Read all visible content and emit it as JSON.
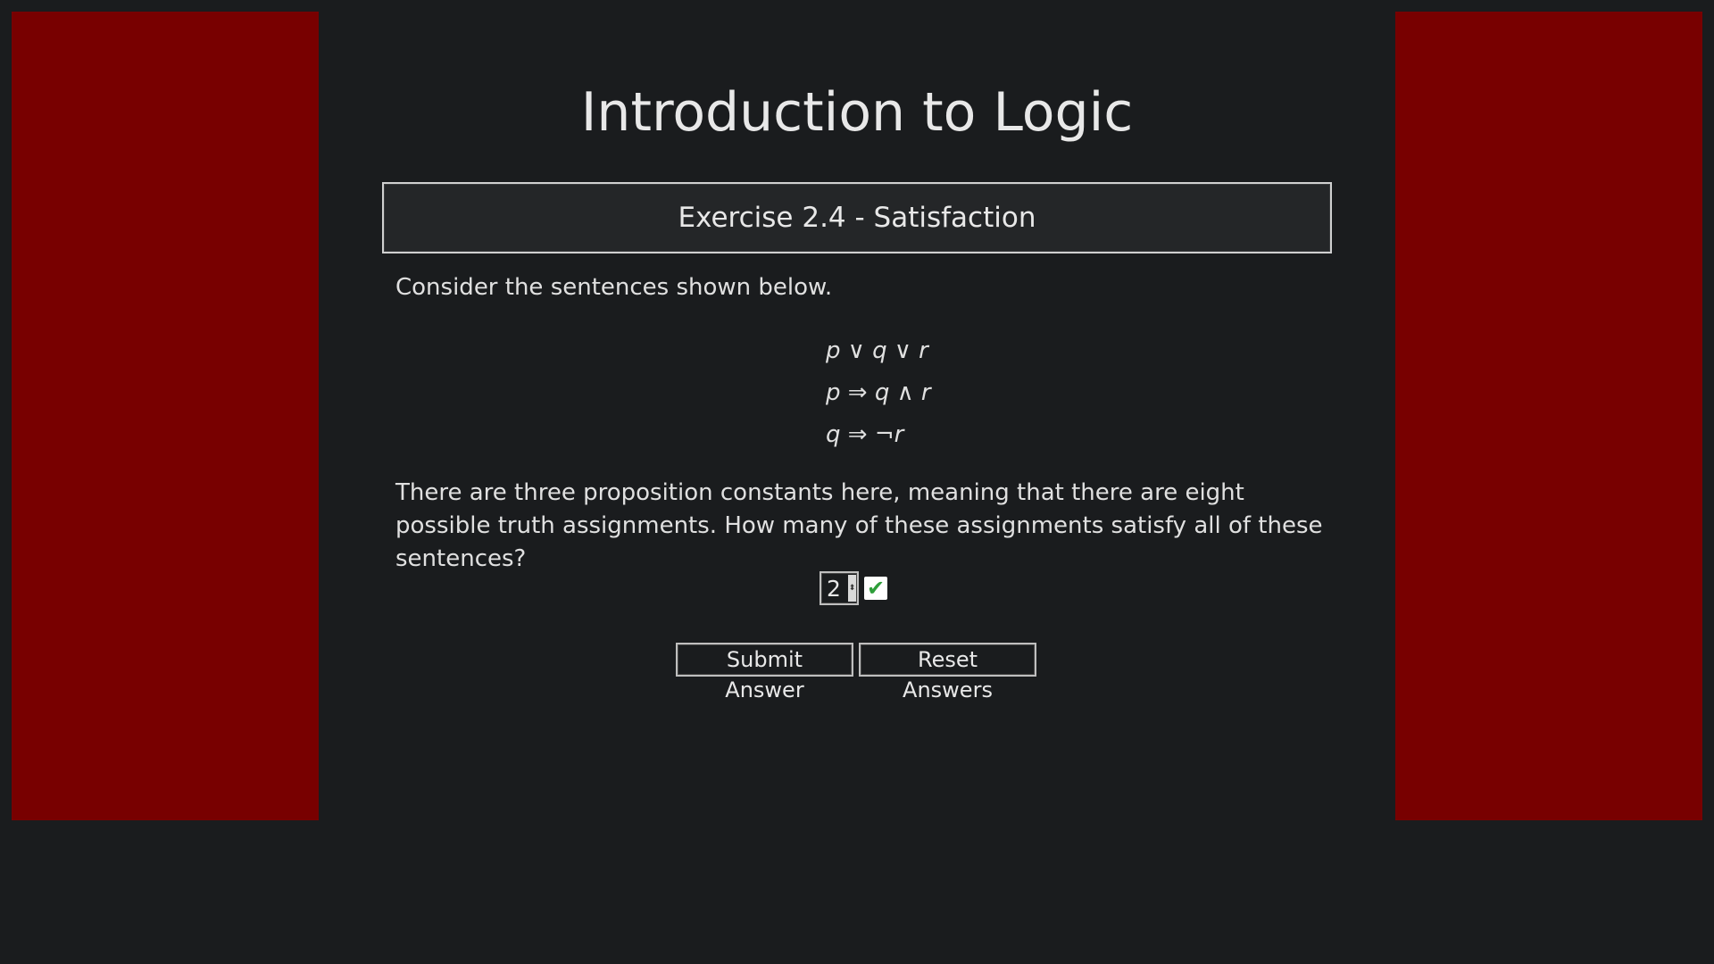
{
  "page": {
    "title": "Introduction to Logic",
    "colors": {
      "background": "#1a1c1e",
      "side_panel": "#780000",
      "text": "#e6e6e6",
      "check_mark": "#2e9e3a"
    }
  },
  "exercise": {
    "header": "Exercise 2.4 - Satisfaction",
    "intro": "Consider the sentences shown below.",
    "sentences": [
      {
        "parts": [
          "p",
          " ∨ ",
          "q",
          " ∨ ",
          "r"
        ]
      },
      {
        "parts": [
          "p",
          " ⇒ ",
          "q",
          " ∧ ",
          "r"
        ]
      },
      {
        "parts": [
          "q",
          " ⇒ ",
          "¬",
          "r",
          ""
        ]
      }
    ],
    "question": "There are three proposition constants here, meaning that there are eight possible truth assignments. How many of these assignments satisfy all of these sentences?"
  },
  "answer": {
    "value": "2",
    "status_icon": "check-icon",
    "status_symbol": "✔"
  },
  "buttons": {
    "submit_label": "Submit Answer",
    "reset_label": "Reset Answers"
  }
}
